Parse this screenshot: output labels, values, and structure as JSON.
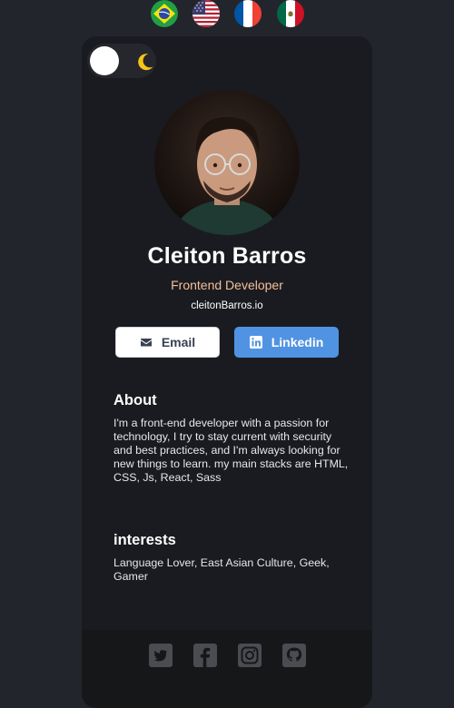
{
  "flags": [
    {
      "icon": "brazil-flag-icon"
    },
    {
      "icon": "usa-flag-icon"
    },
    {
      "icon": "france-flag-icon"
    },
    {
      "icon": "mexico-flag-icon"
    }
  ],
  "theme": {
    "mode_icon": "moon-icon",
    "accent": "#f5c518"
  },
  "profile": {
    "name": "Cleiton Barros",
    "role": "Frontend Developer",
    "site": "cleitonBarros.io",
    "role_color": "#f3bf99"
  },
  "buttons": {
    "email_label": "Email",
    "linkedin_label": "Linkedin",
    "linkedin_color": "#5093e2"
  },
  "about": {
    "title": "About",
    "text": "I'm a front-end developer with a passion for technology, I try to stay current with security and best practices, and I'm always looking for new things to learn. my main stacks are HTML, CSS, Js, React, Sass"
  },
  "interests": {
    "title": "interests",
    "text": "Language Lover, East Asian Culture, Geek, Gamer"
  },
  "social": [
    {
      "icon": "twitter-icon"
    },
    {
      "icon": "facebook-icon"
    },
    {
      "icon": "instagram-icon"
    },
    {
      "icon": "github-icon"
    }
  ]
}
